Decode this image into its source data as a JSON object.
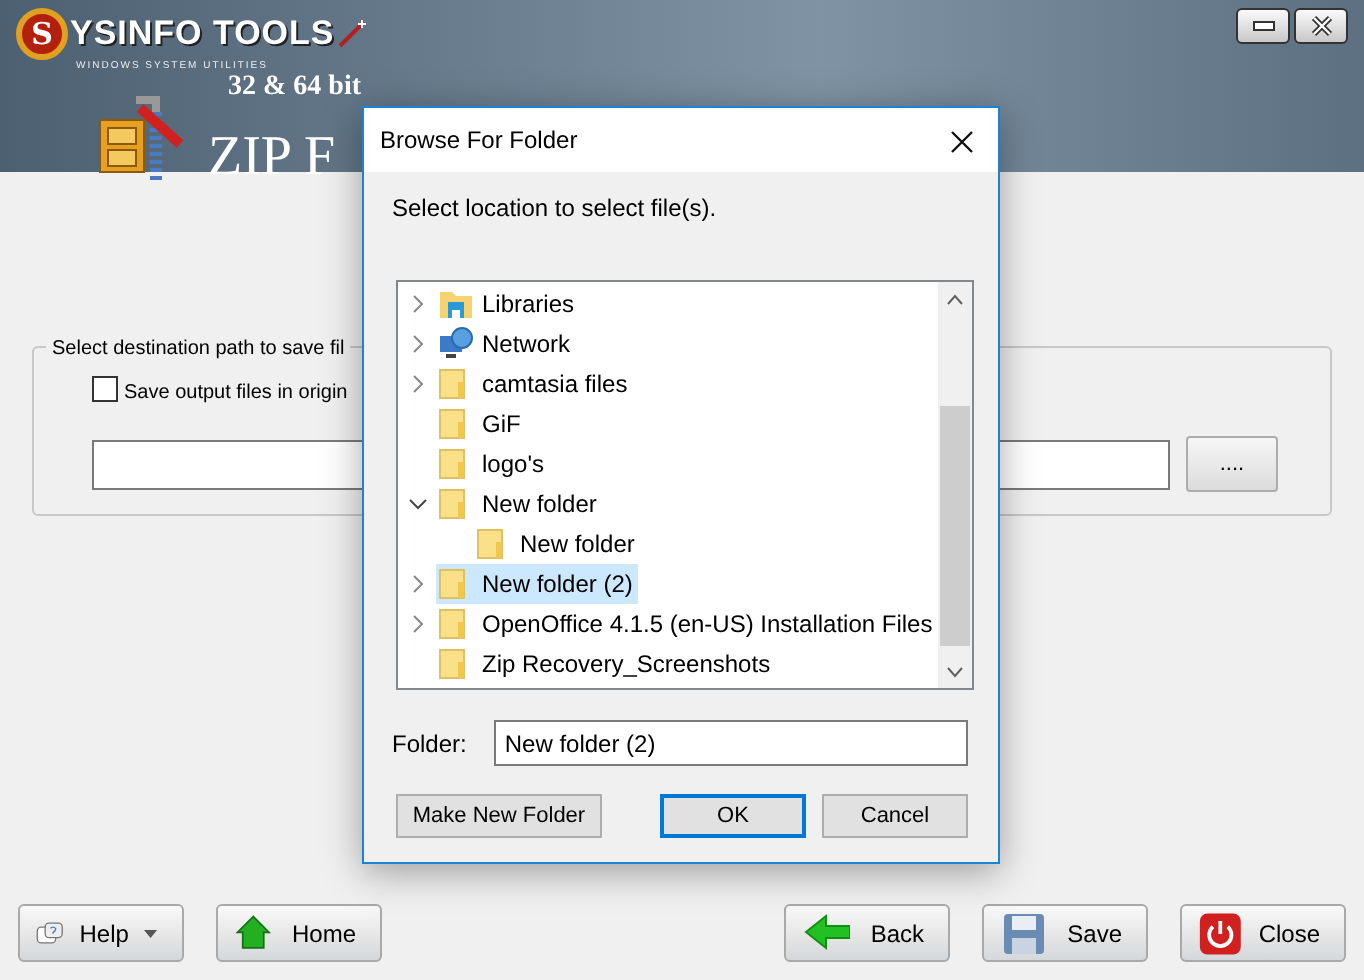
{
  "app": {
    "logo_initial": "S",
    "logo_text": "YSINFO TOOLS",
    "tagline": "WINDOWS SYSTEM UTILITIES",
    "badge": "32 & 64 bit",
    "product_title": "ZIP F"
  },
  "destination": {
    "legend": "Select destination path to save fil",
    "option": {
      "label": "Save output files in origin",
      "checked": false
    },
    "browse_button": "...."
  },
  "footer_buttons": [
    {
      "label": "Help",
      "kind": "help",
      "dropdown": true
    },
    {
      "label": "Home",
      "kind": "home",
      "dropdown": false
    },
    {
      "label": "Back",
      "kind": "back",
      "dropdown": false
    },
    {
      "label": "Save",
      "kind": "save",
      "dropdown": false
    },
    {
      "label": "Close",
      "kind": "close",
      "dropdown": false
    }
  ],
  "dialog": {
    "title": "Browse For Folder",
    "instruction": "Select location to select file(s).",
    "tree": [
      {
        "label": "Libraries",
        "kind": "libraries",
        "expandable": true,
        "expanded": false,
        "selected": false
      },
      {
        "label": "Network",
        "kind": "network",
        "expandable": true,
        "expanded": false,
        "selected": false
      },
      {
        "label": "camtasia files",
        "kind": "folder",
        "expandable": true,
        "expanded": false,
        "selected": false
      },
      {
        "label": "GiF",
        "kind": "folder",
        "expandable": false,
        "selected": false
      },
      {
        "label": "logo's",
        "kind": "folder",
        "expandable": false,
        "selected": false
      },
      {
        "label": "New folder",
        "kind": "folder",
        "expandable": true,
        "expanded": true,
        "selected": false,
        "children": [
          {
            "label": "New folder",
            "kind": "folder",
            "expandable": false,
            "selected": false
          }
        ]
      },
      {
        "label": "New folder (2)",
        "kind": "folder",
        "expandable": true,
        "expanded": false,
        "selected": true
      },
      {
        "label": "OpenOffice 4.1.5 (en-US) Installation Files",
        "kind": "folder",
        "expandable": true,
        "expanded": false,
        "selected": false
      },
      {
        "label": "Zip Recovery_Screenshots",
        "kind": "folder",
        "expandable": false,
        "selected": false
      }
    ],
    "folder_label": "Folder:",
    "folder_value": "New folder (2)",
    "buttons": [
      {
        "label": "Make New Folder",
        "default": false
      },
      {
        "label": "OK",
        "default": true
      },
      {
        "label": "Cancel",
        "default": false
      }
    ]
  }
}
